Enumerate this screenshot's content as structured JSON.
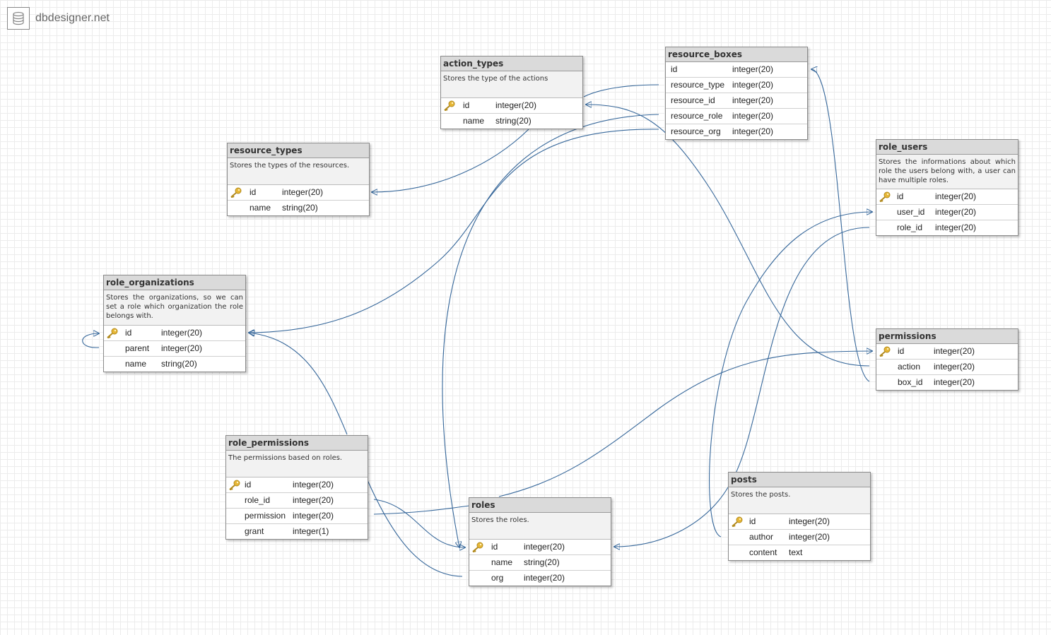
{
  "brand": {
    "name": "dbdesigner.net",
    "icon": "database-icon"
  },
  "colors": {
    "link": "#36679a",
    "header": "#dadada",
    "description_bg": "#f2f2f2",
    "key": "#e0b030"
  },
  "tables": {
    "action_types": {
      "name": "action_types",
      "description": "Stores the type of the actions",
      "fields": [
        {
          "name": "id",
          "type": "integer(20)",
          "primary_key": true
        },
        {
          "name": "name",
          "type": "string(20)"
        }
      ]
    },
    "resource_boxes": {
      "name": "resource_boxes",
      "fields": [
        {
          "name": "id",
          "type": "integer(20)"
        },
        {
          "name": "resource_type",
          "type": "integer(20)"
        },
        {
          "name": "resource_id",
          "type": "integer(20)"
        },
        {
          "name": "resource_role",
          "type": "integer(20)"
        },
        {
          "name": "resource_org",
          "type": "integer(20)"
        }
      ]
    },
    "resource_types": {
      "name": "resource_types",
      "description": "Stores the types of the resources.",
      "fields": [
        {
          "name": "id",
          "type": "integer(20)",
          "primary_key": true
        },
        {
          "name": "name",
          "type": "string(20)"
        }
      ]
    },
    "role_users": {
      "name": "role_users",
      "description": "Stores the informations about which role the users belong with, a user can have multiple roles.",
      "fields": [
        {
          "name": "id",
          "type": "integer(20)",
          "primary_key": true
        },
        {
          "name": "user_id",
          "type": "integer(20)"
        },
        {
          "name": "role_id",
          "type": "integer(20)"
        }
      ]
    },
    "role_organizations": {
      "name": "role_organizations",
      "description": "Stores the organizations, so we can set a role which organization the role belongs with.",
      "fields": [
        {
          "name": "id",
          "type": "integer(20)",
          "primary_key": true
        },
        {
          "name": "parent",
          "type": "integer(20)"
        },
        {
          "name": "name",
          "type": "string(20)"
        }
      ]
    },
    "permissions": {
      "name": "permissions",
      "fields": [
        {
          "name": "id",
          "type": "integer(20)",
          "primary_key": true
        },
        {
          "name": "action",
          "type": "integer(20)"
        },
        {
          "name": "box_id",
          "type": "integer(20)"
        }
      ]
    },
    "role_permissions": {
      "name": "role_permissions",
      "description": "The permissions based on roles.",
      "fields": [
        {
          "name": "id",
          "type": "integer(20)",
          "primary_key": true
        },
        {
          "name": "role_id",
          "type": "integer(20)"
        },
        {
          "name": "permission",
          "type": "integer(20)"
        },
        {
          "name": "grant",
          "type": "integer(1)"
        }
      ]
    },
    "roles": {
      "name": "roles",
      "description": "Stores the roles.",
      "fields": [
        {
          "name": "id",
          "type": "integer(20)",
          "primary_key": true
        },
        {
          "name": "name",
          "type": "string(20)"
        },
        {
          "name": "org",
          "type": "integer(20)"
        }
      ]
    },
    "posts": {
      "name": "posts",
      "description": "Stores the posts.",
      "fields": [
        {
          "name": "id",
          "type": "integer(20)",
          "primary_key": true
        },
        {
          "name": "author",
          "type": "integer(20)"
        },
        {
          "name": "content",
          "type": "text"
        }
      ]
    }
  },
  "relations": [
    {
      "from": "action_types.id",
      "to": "resource_types.id"
    },
    {
      "from": "resource_boxes.resource_type",
      "to": "action_types"
    },
    {
      "from": "resource_boxes.resource_role",
      "to": "roles.id"
    },
    {
      "from": "resource_boxes.resource_org",
      "to": "role_organizations.id"
    },
    {
      "from": "permissions.action",
      "to": "action_types.id"
    },
    {
      "from": "permissions.box_id",
      "to": "resource_boxes.id"
    },
    {
      "from": "role_users.role_id",
      "to": "roles.id"
    },
    {
      "from": "posts.author",
      "to": "role_users.user_id"
    },
    {
      "from": "roles",
      "to": "permissions.id"
    },
    {
      "from": "role_organizations.parent",
      "to": "role_organizations.id"
    },
    {
      "from": "role_permissions",
      "to": "role_organizations.id"
    },
    {
      "from": "role_permissions.role_id",
      "to": "roles.id"
    },
    {
      "from": "role_permissions.permission",
      "to": "roles"
    },
    {
      "from": "role_permissions",
      "to": "roles.org"
    }
  ]
}
